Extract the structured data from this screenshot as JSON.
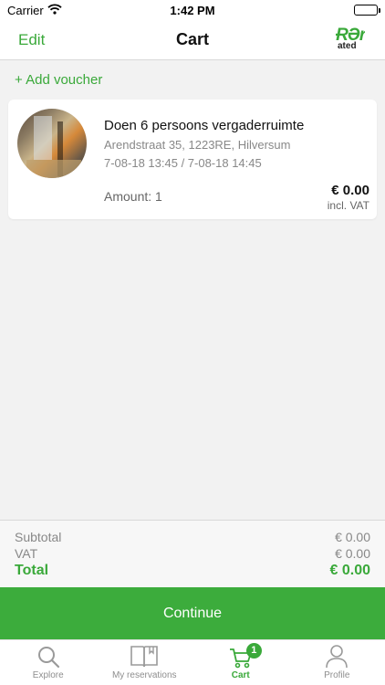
{
  "status_bar": {
    "carrier": "Carrier",
    "time": "1:42 PM"
  },
  "navbar": {
    "edit_label": "Edit",
    "title": "Cart",
    "logo_top": "ɌƏr",
    "logo_bottom": "ated"
  },
  "voucher": {
    "label": "+ Add voucher"
  },
  "cart_item": {
    "name": "Doen 6 persoons vergaderruimte",
    "address": "Arendstraat  35, 1223RE, Hilversum",
    "dates": "7-08-18 13:45 / 7-08-18 14:45",
    "amount": "Amount: 1",
    "price": "€ 0.00",
    "vat_note": "incl. VAT"
  },
  "totals": {
    "subtotal_label": "Subtotal",
    "subtotal_value": "€ 0.00",
    "vat_label": "VAT",
    "vat_value": "€ 0.00",
    "total_label": "Total",
    "total_value": "€ 0.00"
  },
  "continue_label": "Continue",
  "tabs": [
    {
      "label": "Explore",
      "icon": "search-icon"
    },
    {
      "label": "My reservations",
      "icon": "book-icon"
    },
    {
      "label": "Cart",
      "icon": "cart-icon",
      "badge": "1",
      "active": true
    },
    {
      "label": "Profile",
      "icon": "person-icon"
    }
  ],
  "colors": {
    "accent": "#3aa93a",
    "button": "#3cac3c"
  }
}
